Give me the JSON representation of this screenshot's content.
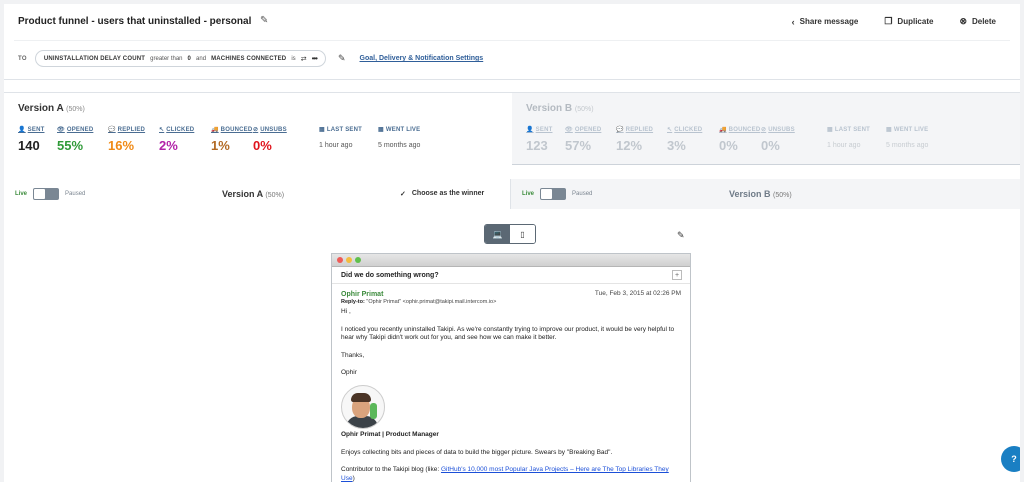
{
  "header": {
    "title": "Product funnel - users that uninstalled - personal",
    "actions": [
      {
        "label": "Share message",
        "icon": "share-icon"
      },
      {
        "label": "Duplicate",
        "icon": "duplicate-icon"
      },
      {
        "label": "Delete",
        "icon": "delete-icon"
      }
    ],
    "to_label": "TO",
    "filter": {
      "attr1": "UNINSTALLATION DELAY COUNT",
      "op1": "greater than",
      "val1": "0",
      "conj": "and",
      "attr2": "MACHINES CONNECTED",
      "op2": "is",
      "more": "•••"
    },
    "goal_link": "Goal, Delivery & Notification Settings"
  },
  "stats": {
    "a": {
      "name": "Version A",
      "pct": "(50%)",
      "metrics": [
        {
          "label": "SENT",
          "value": "140",
          "color": "#222222"
        },
        {
          "label": "OPENED",
          "value": "55%",
          "color": "#2f9a38"
        },
        {
          "label": "REPLIED",
          "value": "16%",
          "color": "#f08a16"
        },
        {
          "label": "CLICKED",
          "value": "2%",
          "color": "#b222a8"
        },
        {
          "label": "BOUNCED",
          "value": "1%",
          "color": "#b26a24"
        },
        {
          "label": "UNSUBS",
          "value": "0%",
          "color": "#e0141d"
        },
        {
          "label": "LAST SENT",
          "value": "1 hour ago"
        },
        {
          "label": "WENT LIVE",
          "value": "5 months ago"
        }
      ]
    },
    "b": {
      "name": "Version B",
      "pct": "(50%)",
      "metrics": [
        {
          "label": "SENT",
          "value": "123"
        },
        {
          "label": "OPENED",
          "value": "57%"
        },
        {
          "label": "REPLIED",
          "value": "12%"
        },
        {
          "label": "CLICKED",
          "value": "3%"
        },
        {
          "label": "BOUNCED",
          "value": "0%"
        },
        {
          "label": "UNSUBS",
          "value": "0%"
        },
        {
          "label": "LAST SENT",
          "value": "1 hour ago"
        },
        {
          "label": "WENT LIVE",
          "value": "5 months ago"
        }
      ]
    }
  },
  "variants": {
    "a": {
      "live": "Live",
      "paused": "Paused",
      "name": "Version A",
      "pct": "(50%)",
      "winner": "Choose as the winner"
    },
    "b": {
      "live": "Live",
      "paused": "Paused",
      "name": "Version B",
      "pct": "(50%)"
    }
  },
  "preview": {
    "subject": "Did we do something wrong?",
    "sender": "Ophir Primat",
    "date": "Tue, Feb 3, 2015 at 02:26 PM",
    "reply_to_label": "Reply-to:",
    "reply_to": "\"Ophir Primat\" <ophir.primat@takipi.mail.intercom.io>",
    "greeting": "Hi ,",
    "para1": "I noticed you recently uninstalled Takipi. As we're constantly trying to improve our product, it would be very helpful to hear why Takipi didn't work out for you, and see how we can make it better.",
    "thanks": "Thanks,",
    "signoff": "Ophir",
    "sig_title": "Ophir Primat | Product Manager",
    "bio": "Enjoys collecting bits and pieces of data to build the bigger picture. Swears by \"Breaking Bad\".",
    "contrib_prefix": "Contributor to the Takipi blog (like: ",
    "contrib_link": "GitHub's 10,000 most Popular Java Projects – Here are The Top Libraries They Use",
    "contrib_suffix": ")"
  },
  "help_icon": "help-chat-icon"
}
